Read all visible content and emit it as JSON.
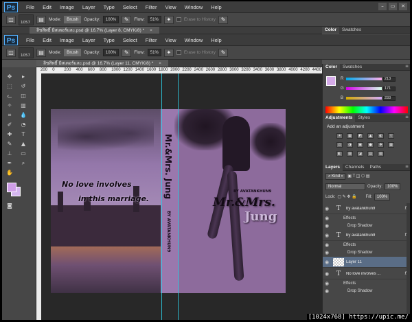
{
  "app": {
    "logo": "Ps"
  },
  "menu": [
    "File",
    "Edit",
    "Image",
    "Layer",
    "Type",
    "Select",
    "Filter",
    "View",
    "Window",
    "Help"
  ],
  "window_controls": [
    "–",
    "▭",
    "✕"
  ],
  "options": {
    "brush_size": "1057",
    "mode_label": "Mode:",
    "mode_value": "Brush",
    "opacity_label": "Opacity:",
    "opacity_value": "100%",
    "flow_label": "Flow:",
    "flow_value": "51%",
    "erase_history": "Erase to History"
  },
  "doc_tab_top": "ลิขสิทธิ์ มิสเตอร์และ.psd @ 16.7% (Layer 8, CMYK/8) *",
  "doc_tab": "ลิขสิทธิ์ มิสเตอร์และ.psd @ 16.7% (Layer 11, CMYK/8) *",
  "ruler_ticks": [
    "200",
    "0",
    "200",
    "400",
    "600",
    "800",
    "1000",
    "1200",
    "1400",
    "1600",
    "1800",
    "2000",
    "2200",
    "2400",
    "2600",
    "2800",
    "3000",
    "3200",
    "3400",
    "3600",
    "3800",
    "4000",
    "4200",
    "4400"
  ],
  "cover": {
    "tagline_1": "No love involves",
    "tagline_2": "in this marriage.",
    "spine_title": "Mr.&Mrs. Jung",
    "spine_author": "BY AVATANKHUN9",
    "by_line": "BY AVATANKHUN9",
    "title_main": "Mr.&Mrs.",
    "title_sub": "Jung"
  },
  "panels": {
    "color_tabs": [
      "Color",
      "Swatches"
    ],
    "color": {
      "R": "213",
      "G": "171",
      "B": "233",
      "fg_hex": "#d5abe9"
    },
    "adjust_tabs": [
      "Adjustments",
      "Styles"
    ],
    "adjust_title": "Add an adjustment",
    "adjust_icons_row1": [
      "☀",
      "▦",
      "◩",
      "▲",
      "◐",
      "▽"
    ],
    "adjust_icons_row2": [
      "⚖",
      "◑",
      "▣",
      "●",
      "❖",
      "▦"
    ],
    "adjust_icons_row3": [
      "◧",
      "▨",
      "◪",
      "▤",
      "▧"
    ],
    "layers_tabs": [
      "Layers",
      "Channels",
      "Paths"
    ],
    "kind_label": "Kind",
    "blend_mode": "Normal",
    "opacity_label": "Opacity:",
    "opacity_value": "100%",
    "lock_label": "Lock:",
    "fill_label": "Fill:",
    "fill_value": "100%",
    "layers": [
      {
        "name": "by avatankhun9",
        "type": "T",
        "fx": "fx"
      },
      {
        "effects": "Effects",
        "effect": "Drop Shadow"
      },
      {
        "name": "by avatankhun9",
        "type": "T",
        "fx": "fx"
      },
      {
        "effects": "Effects",
        "effect": "Drop Shadow"
      },
      {
        "name": "Layer 11",
        "type": "thumb"
      },
      {
        "name": "No love involves ...",
        "type": "T",
        "fx": "fx"
      },
      {
        "effects": "Effects",
        "effect": "Drop Shadow"
      }
    ]
  },
  "watermark": "[1024x768] https://upic.me/"
}
